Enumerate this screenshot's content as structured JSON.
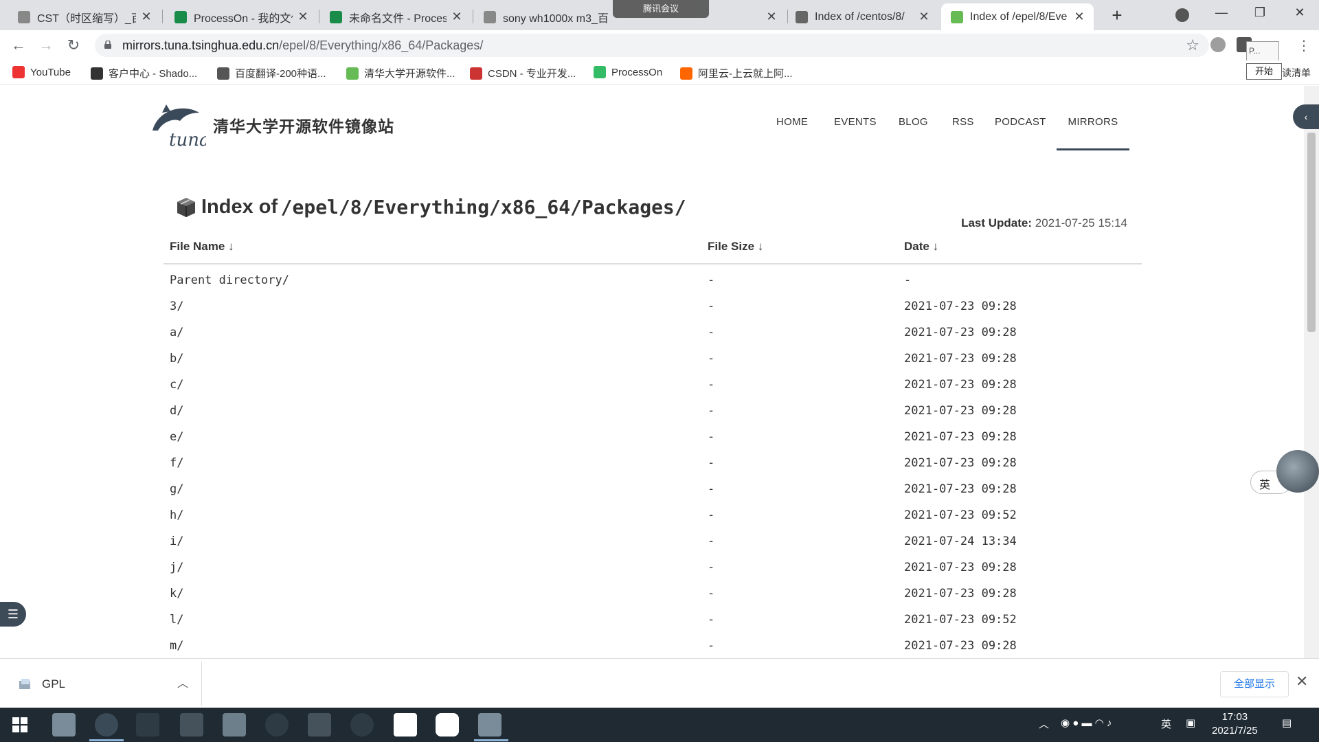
{
  "browser": {
    "tabs": [
      {
        "title": "CST（时区缩写）_百度",
        "active": false
      },
      {
        "title": "ProcessOn - 我的文件",
        "active": false
      },
      {
        "title": "未命名文件 - Process",
        "active": false
      },
      {
        "title": "sony wh1000x m3_百",
        "active": false
      },
      {
        "title": "Index of /centos/8/",
        "active": false
      },
      {
        "title": "Index of /epel/8/Eve",
        "active": true
      }
    ],
    "meeting_pill": "腾讯会议",
    "url_host": "mirrors.tuna.tsinghua.edu.cn",
    "url_path": "/epel/8/Everything/x86_64/Packages/",
    "ext_tooltip": "P...",
    "start_tip": "开始",
    "bookmarks_right_label": "读清单",
    "bookmarks": [
      {
        "label": "YouTube",
        "color": "#e33"
      },
      {
        "label": "客户中心 - Shado...",
        "color": "#333"
      },
      {
        "label": "百度翻译-200种语...",
        "color": "#555"
      },
      {
        "label": "清华大学开源软件...",
        "color": "#6b5"
      },
      {
        "label": "CSDN - 专业开发...",
        "color": "#c33"
      },
      {
        "label": "ProcessOn",
        "color": "#3b6"
      },
      {
        "label": "阿里云-上云就上阿...",
        "color": "#f60"
      }
    ]
  },
  "site": {
    "logo_text": "tuna",
    "name": "清华大学开源软件镜像站",
    "nav": [
      "HOME",
      "EVENTS",
      "BLOG",
      "RSS",
      "PODCAST",
      "MIRRORS"
    ],
    "active_nav": "MIRRORS"
  },
  "listing": {
    "title_prefix": "Index of",
    "title_path": "/epel/8/Everything/x86_64/Packages/",
    "last_update_label": "Last Update:",
    "last_update_value": "2021-07-25 15:14",
    "headers": {
      "name": "File Name ↓",
      "size": "File Size ↓",
      "date": "Date ↓"
    },
    "rows": [
      {
        "name": "Parent directory/",
        "size": "-",
        "date": "-"
      },
      {
        "name": "3/",
        "size": "-",
        "date": "2021-07-23 09:28"
      },
      {
        "name": "a/",
        "size": "-",
        "date": "2021-07-23 09:28"
      },
      {
        "name": "b/",
        "size": "-",
        "date": "2021-07-23 09:28"
      },
      {
        "name": "c/",
        "size": "-",
        "date": "2021-07-23 09:28"
      },
      {
        "name": "d/",
        "size": "-",
        "date": "2021-07-23 09:28"
      },
      {
        "name": "e/",
        "size": "-",
        "date": "2021-07-23 09:28"
      },
      {
        "name": "f/",
        "size": "-",
        "date": "2021-07-23 09:28"
      },
      {
        "name": "g/",
        "size": "-",
        "date": "2021-07-23 09:28"
      },
      {
        "name": "h/",
        "size": "-",
        "date": "2021-07-23 09:52"
      },
      {
        "name": "i/",
        "size": "-",
        "date": "2021-07-24 13:34"
      },
      {
        "name": "j/",
        "size": "-",
        "date": "2021-07-23 09:28"
      },
      {
        "name": "k/",
        "size": "-",
        "date": "2021-07-23 09:28"
      },
      {
        "name": "l/",
        "size": "-",
        "date": "2021-07-23 09:52"
      },
      {
        "name": "m/",
        "size": "-",
        "date": "2021-07-23 09:28"
      }
    ]
  },
  "float": {
    "lang": "英"
  },
  "downloads": {
    "file": "GPL",
    "show_all": "全部显示"
  },
  "taskbar": {
    "ime": "英",
    "time": "17:03",
    "date": "2021/7/25"
  }
}
